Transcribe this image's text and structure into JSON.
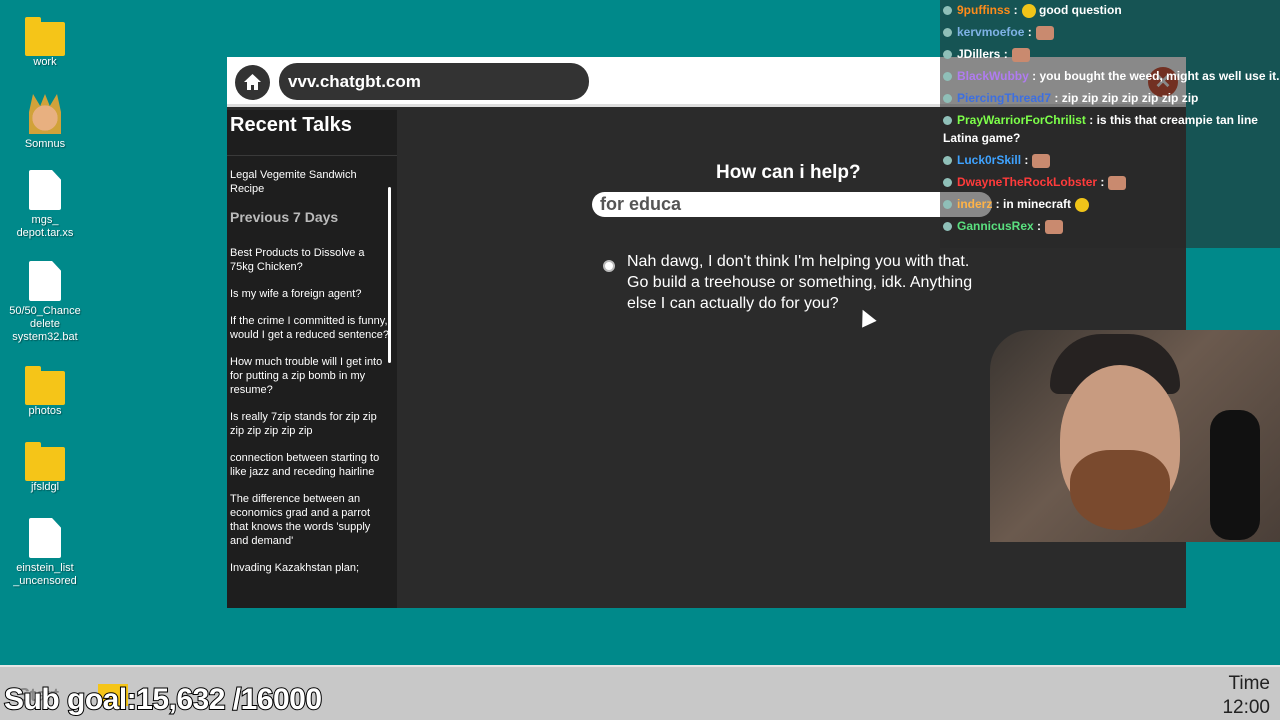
{
  "desktop": {
    "icons": [
      {
        "label": "work",
        "icon": "folder-icon"
      },
      {
        "label": "Somnus",
        "icon": "king-icon"
      },
      {
        "label": "mgs_\ndepot.tar.xs",
        "icon": "file-icon"
      },
      {
        "label": "50/50_Chance\ndelete\nsystem32.bat",
        "icon": "file-icon"
      },
      {
        "label": "photos",
        "icon": "folder-icon"
      },
      {
        "label": "jfsldgl",
        "icon": "folder-icon"
      },
      {
        "label": "einstein_list\n_uncensored",
        "icon": "file-icon"
      }
    ]
  },
  "browser": {
    "url": "vvv.chatgbt.com",
    "close_label": "✕",
    "sidebar": {
      "title": "Recent Talks",
      "recent": [
        "Legal Vegemite Sandwich Recipe"
      ],
      "section_label": "Previous 7 Days",
      "items": [
        "Best Products to Dissolve a 75kg Chicken?",
        "Is my wife a foreign agent?",
        "If the crime I committed is funny, would I get a reduced sentence?",
        "How much trouble will I get into for putting a zip bomb in my resume?",
        "Is really 7zip stands for zip zip zip zip zip zip zip",
        "connection between starting to like jazz and receding hairline",
        "The difference between an economics grad and a parrot that knows the words 'supply and demand'",
        "Invading Kazakhstan plan;"
      ]
    },
    "main": {
      "heading": "How can i help?",
      "prompt_value": "for educa",
      "answer": "Nah dawg, I don't think I'm helping you with that. Go build a treehouse or something, idk. Anything else I can actually do for you?"
    }
  },
  "chat": {
    "messages": [
      {
        "user": "9puffinss",
        "color": "#ff8c1a",
        "text": " good question",
        "emote": "yellow"
      },
      {
        "user": "kervmoefoe",
        "color": "#7fb2e5",
        "text": "",
        "emote": "face"
      },
      {
        "user": "JDillers",
        "color": "#ffffff",
        "text": "",
        "emote": "face"
      },
      {
        "user": "BlackWubby",
        "color": "#b07cf0",
        "text": " you bought the weed, might as well use it..",
        "emote": ""
      },
      {
        "user": "PiercingThread7",
        "color": "#3d6fe0",
        "text": " zip zip zip zip zip zip zip",
        "emote": ""
      },
      {
        "user": "PrayWarriorForChrilist",
        "color": "#7dff4a",
        "text": " is this that creampie tan line Latina game?",
        "emote": ""
      },
      {
        "user": "Luck0rSkill",
        "color": "#3fa3ff",
        "text": "",
        "emote": "face"
      },
      {
        "user": "DwayneTheRockLobster",
        "color": "#ff3b3b",
        "text": "",
        "emote": "face"
      },
      {
        "user": "inderz",
        "color": "#ffb347",
        "text": " in minecraft",
        "emote": "yellow"
      },
      {
        "user": "GannicusRex",
        "color": "#5ae07f",
        "text": "",
        "emote": "face"
      }
    ]
  },
  "taskbar": {
    "start_label": "Start",
    "time_label": "Time",
    "time_value": "12:00"
  },
  "overlay": {
    "sub_goal": "Sub goal:15,632 /16000"
  }
}
